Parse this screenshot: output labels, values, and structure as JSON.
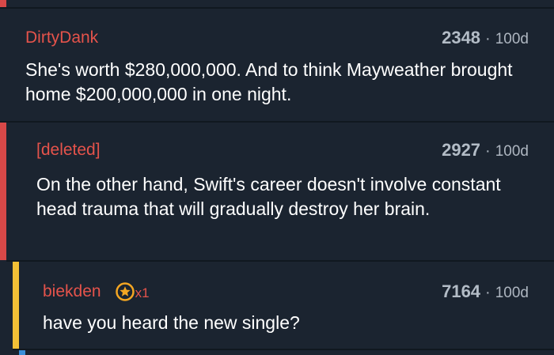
{
  "colors": {
    "background": "#1b2430",
    "divider": "#101820",
    "author": "#e5534b",
    "meta": "#aeb6c0",
    "thread_red": "#d84848",
    "thread_yellow": "#f3c036",
    "thread_blue": "#3a8fd9",
    "award_gold": "#f4a622"
  },
  "comments": [
    {
      "author": "DirtyDank",
      "score": "2348",
      "separator": "·",
      "age": "100d",
      "body": "She's worth $280,000,000. And to think Mayweather brought home $200,000,000 in one night."
    },
    {
      "author": "[deleted]",
      "score": "2927",
      "separator": "·",
      "age": "100d",
      "body": "On the other hand, Swift's career doesn't involve constant head trauma that will gradually destroy her brain."
    },
    {
      "author": "biekden",
      "award_icon": "star-award-icon",
      "award_count": "x1",
      "score": "7164",
      "separator": "·",
      "age": "100d",
      "body": "have you heard the new single?"
    }
  ]
}
